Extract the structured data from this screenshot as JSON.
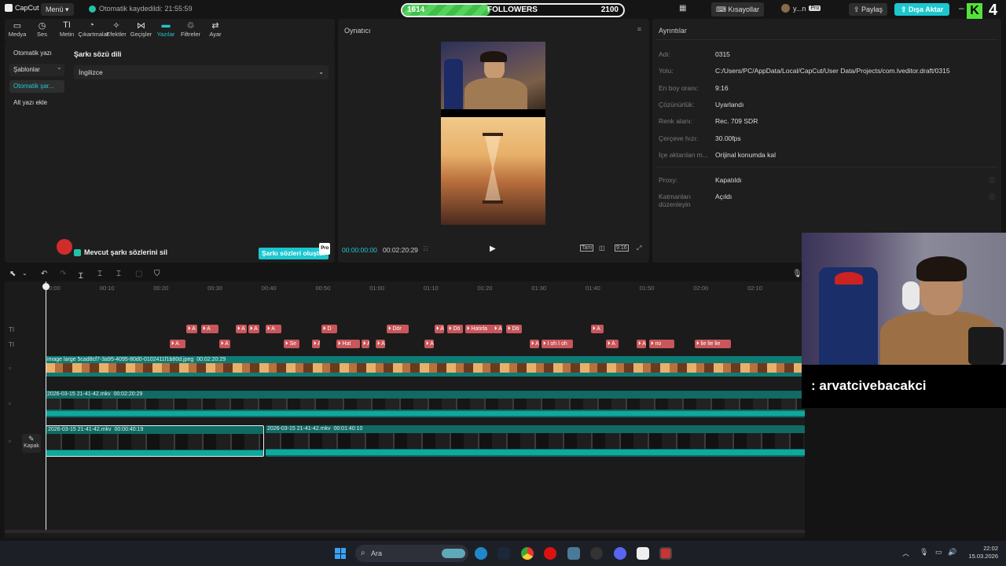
{
  "topbar": {
    "app_name": "CapCut",
    "menu_label": "Menü",
    "autosave": "Otomatik kaydedildi: 21:55:59",
    "followers": {
      "current": "1614",
      "label": "FOLLOWERS",
      "goal": "2100",
      "progress": 0.4
    },
    "layout_icon": "▦",
    "shortcuts": "Kısayollar",
    "user": "y...n",
    "pro": "Pro",
    "share": "Paylaş",
    "export": "Dışa Aktar",
    "overlay_badge": "4",
    "k_letter": "K"
  },
  "toolbar": [
    {
      "label": "Medya",
      "icon": "▭"
    },
    {
      "label": "Ses",
      "icon": "◷"
    },
    {
      "label": "Metin",
      "icon": "TI"
    },
    {
      "label": "Çıkartmalar",
      "icon": "◔"
    },
    {
      "label": "Efektler",
      "icon": "✧"
    },
    {
      "label": "Geçişler",
      "icon": "⋈"
    },
    {
      "label": "Yazılar",
      "icon": "▬"
    },
    {
      "label": "Filtreler",
      "icon": "♲"
    },
    {
      "label": "Ayar",
      "icon": "⇄"
    }
  ],
  "active_tool_index": 6,
  "captions": {
    "side_items": [
      "Otomatik yazı",
      "Şablonlar",
      "Otomatik şar...",
      "Alt yazı ekle"
    ],
    "selected_index": 2,
    "section_title": "Şarkı sözü dili",
    "language": "İngilizce",
    "clear_checkbox": "Mevcut şarkı sözlerini sil",
    "generate_button": "Şarkı sözleri oluştur",
    "generate_badge": "Pro"
  },
  "player": {
    "title": "Oynatıcı",
    "current_time": "00:00:00:00",
    "total_time": "00:02:20:29",
    "ratio": "9:16",
    "full_label": "Tam"
  },
  "details": {
    "title": "Ayrıntılar",
    "rows": [
      {
        "label": "Adı:",
        "value": "0315"
      },
      {
        "label": "Yolu:",
        "value": "C:/Users/PC/AppData/Local/CapCut/User Data/Projects/com.lveditor.draft/0315"
      },
      {
        "label": "En boy oranı:",
        "value": "9:16"
      },
      {
        "label": "Çözünürlük:",
        "value": "Uyarlandı"
      },
      {
        "label": "Renk alanı:",
        "value": "Rec. 709 SDR"
      },
      {
        "label": "Çerçeve hızı:",
        "value": "30.00fps"
      },
      {
        "label": "İçe aktarılan m...",
        "value": "Orijinal konumda kal"
      }
    ],
    "rows2": [
      {
        "label": "Proxy:",
        "value": "Kapatıldı"
      },
      {
        "label": "Katmanları düzenleyin",
        "value": "Açıldı"
      }
    ]
  },
  "timeline": {
    "ticks": [
      "00:00",
      "00:10",
      "00:20",
      "00:30",
      "00:40",
      "00:50",
      "01:00",
      "01:10",
      "01:20",
      "01:30",
      "01:40",
      "01:50",
      "02:00",
      "02:10"
    ],
    "caption_row1": [
      "A",
      "A",
      "A",
      "A",
      "A",
      "D",
      "Dör",
      "A",
      "Dö",
      "Hatırla",
      "A",
      "Dö",
      "A"
    ],
    "caption_row2": [
      "A",
      "A",
      "Se",
      "A",
      "Hat",
      "A",
      "A",
      "A",
      "A",
      "I oh I oh",
      "A",
      "A",
      "no",
      "lie lie lie"
    ],
    "clips": [
      {
        "name": "image large 5cad8cf7-3a95-4095-80d0-0102411f1b80d.jpeg",
        "duration": "00:02:20:29"
      },
      {
        "name": "2026-03-15 21-41-42.mkv",
        "duration": "00:02:20:29"
      },
      {
        "name": "2026-03-15 21-41-42.mkv",
        "duration": "00:00:40:19"
      },
      {
        "name": "2026-03-15 21-41-42.mkv",
        "duration": "00:01:40:10"
      }
    ],
    "cover_label": "Kapak"
  },
  "overlay": {
    "username": ": arvatcivebacakci"
  },
  "taskbar": {
    "search_placeholder": "Ara",
    "time": "22:02",
    "date": "15.03.2026"
  }
}
